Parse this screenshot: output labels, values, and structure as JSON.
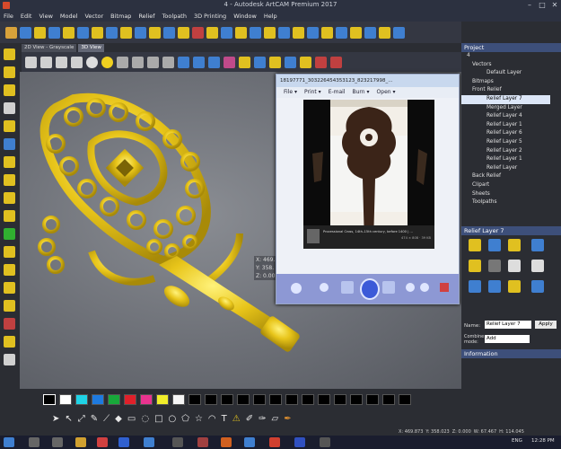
{
  "window": {
    "title": "4 - Autodesk ArtCAM Premium 2017",
    "min": "–",
    "max": "□",
    "close": "✕"
  },
  "menu": [
    "File",
    "Edit",
    "View",
    "Model",
    "Vector",
    "Bitmap",
    "Relief",
    "Toolpath",
    "3D Printing",
    "Window",
    "Help"
  ],
  "view_tabs": [
    "2D View - Grayscale",
    "3D View"
  ],
  "coords": [
    "X: 469.",
    "Y: 358.",
    "Z: 0.00"
  ],
  "image_viewer": {
    "title": "18197771_303226454353123_823217998_...",
    "menu": [
      "File ▾",
      "Print ▾",
      "E-mail",
      "Burn ▾",
      "Open ▾"
    ],
    "caption": "Processional Cross, 14th–15th century, before 1400 | ...",
    "caption_size": "474 × 808 · 39 KB"
  },
  "project": {
    "header": "Project",
    "root": "4",
    "items": [
      {
        "label": "Vectors",
        "indent": 1
      },
      {
        "label": "Default Layer",
        "indent": 3
      },
      {
        "label": "Bitmaps",
        "indent": 1
      },
      {
        "label": "Front Relief",
        "indent": 1
      },
      {
        "label": "Relief Layer 7",
        "indent": 3
      },
      {
        "label": "Merged Layer",
        "indent": 3
      },
      {
        "label": "Relief Layer 4",
        "indent": 3
      },
      {
        "label": "Relief Layer 1",
        "indent": 3
      },
      {
        "label": "Relief Layer 6",
        "indent": 3
      },
      {
        "label": "Relief Layer 5",
        "indent": 3
      },
      {
        "label": "Relief Layer 2",
        "indent": 3
      },
      {
        "label": "Relief Layer 1",
        "indent": 3
      },
      {
        "label": "Relief Layer",
        "indent": 3
      },
      {
        "label": "Back Relief",
        "indent": 1
      },
      {
        "label": "Clipart",
        "indent": 1
      },
      {
        "label": "Sheets",
        "indent": 1
      },
      {
        "label": "Toolpaths",
        "indent": 1
      }
    ]
  },
  "layer_panel": {
    "header": "Relief Layer 7",
    "name_label": "Name:",
    "name_value": "Relief Layer 7",
    "apply": "Apply",
    "combine_label": "Combine mode:",
    "combine_value": "Add",
    "info_header": "Information"
  },
  "status": {
    "x": "X: 469.873",
    "y": "Y: 358.023",
    "z": "Z: 0.000",
    "w": "W: 67.467",
    "h": "H: 114.045"
  },
  "taskbar": {
    "lang": "ENG",
    "time": "12:28 PM"
  },
  "colors": {
    "accent": "#3d4f7a",
    "relief": "#e8c51a",
    "panel": "#2b2d33"
  }
}
